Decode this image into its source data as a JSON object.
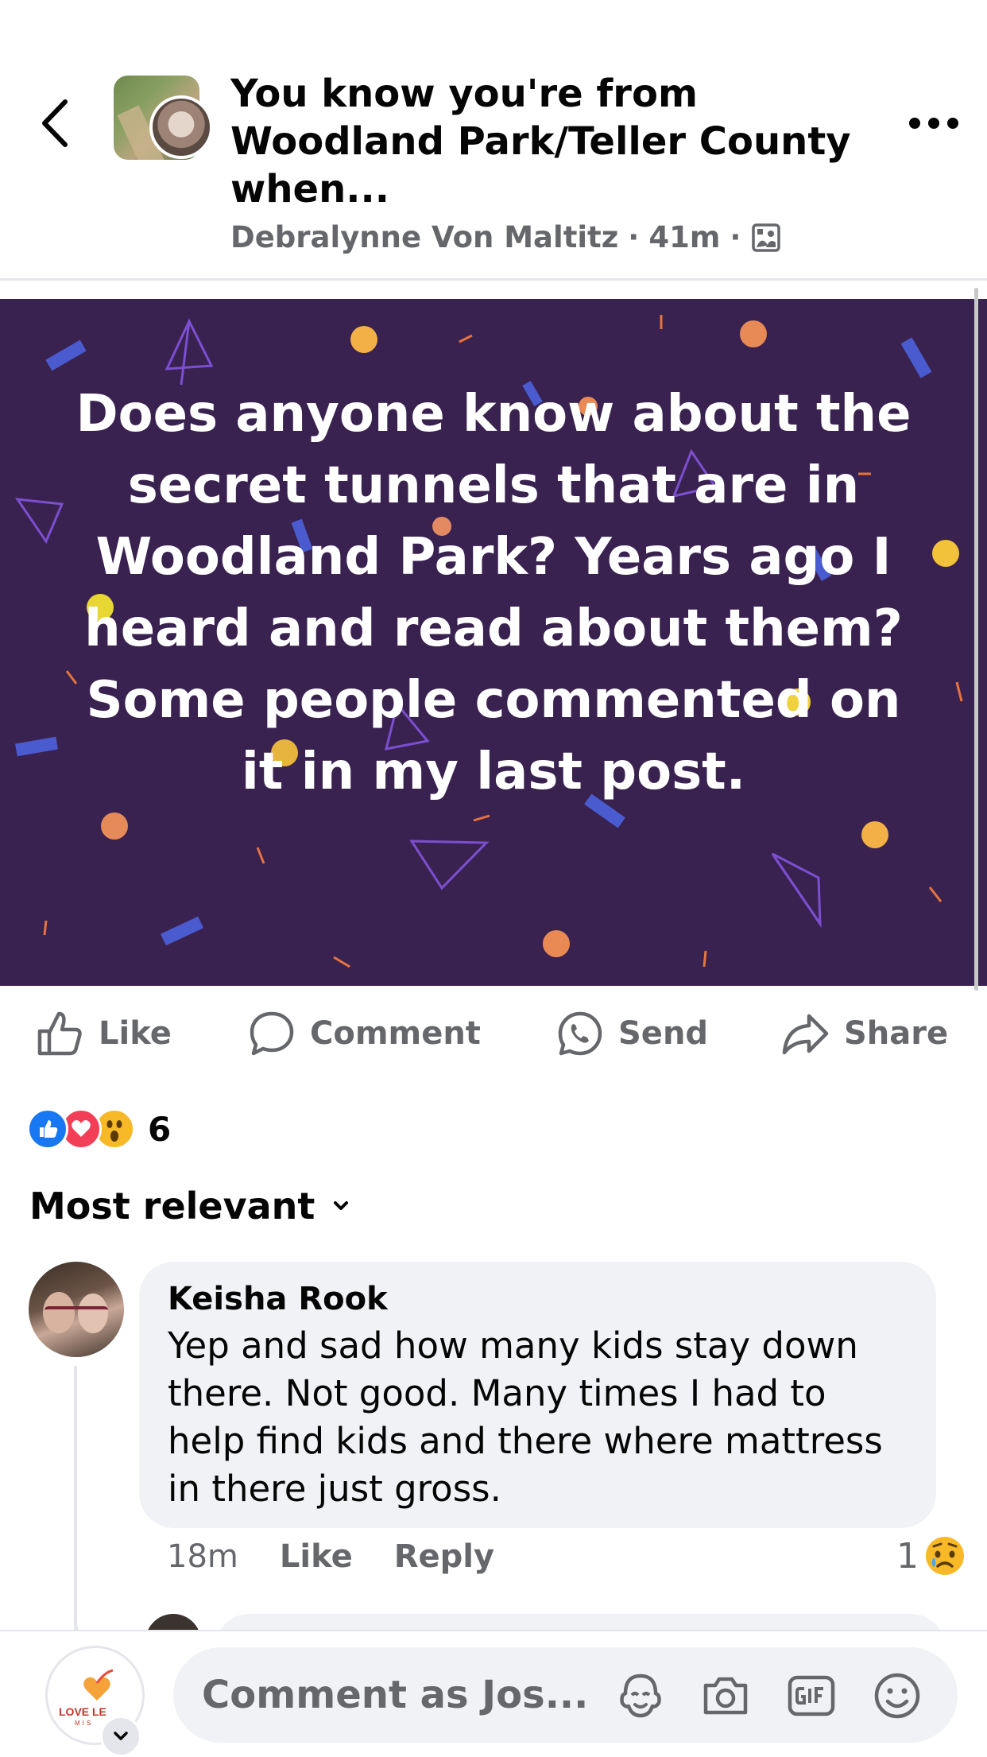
{
  "header": {
    "title": "You know you're from Woodland Park/Teller County when...",
    "author": "Debralynne Von Maltitz",
    "time": "41m",
    "separator": "·"
  },
  "post": {
    "text": "Does anyone know about the secret tunnels that are in Woodland Park? Years ago I heard and read about them? Some people commented on it in my last post.",
    "background_color": "#3a2250"
  },
  "actions": {
    "like": "Like",
    "comment": "Comment",
    "send": "Send",
    "share": "Share"
  },
  "reactions": {
    "types": [
      "like",
      "love",
      "wow"
    ],
    "count": "6"
  },
  "comments_sort": {
    "label": "Most relevant"
  },
  "comment": {
    "author": "Keisha Rook",
    "text": "Yep and sad how many kids stay down there. Not good. Many times I had to help find kids  and there where mattress in there just gross.",
    "time": "18m",
    "like": "Like",
    "reply": "Reply",
    "reaction_count": "1",
    "reaction_type": "sad"
  },
  "composer": {
    "placeholder": "Comment as Jos...",
    "avatar_logo_text": "LOVE LE",
    "avatar_logo_sub": "MIS"
  },
  "colors": {
    "accent_blue": "#1877f2",
    "love_red": "#f33e58",
    "wow_yellow": "#f7b928",
    "secondary_text": "#65676b"
  }
}
